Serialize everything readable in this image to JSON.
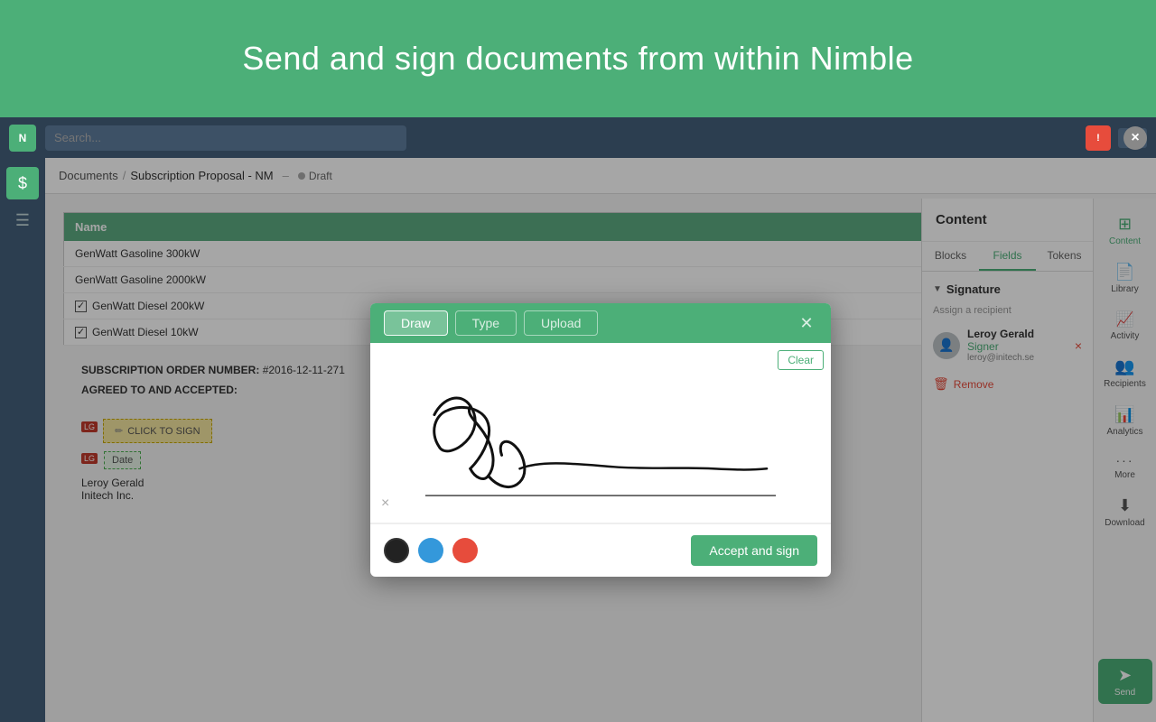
{
  "banner": {
    "title": "Send and sign documents from within Nimble"
  },
  "breadcrumb": {
    "documents": "Documents",
    "separator": "/",
    "current": "Subscription Proposal - NM",
    "dash": "–",
    "status": "Draft"
  },
  "table": {
    "header": "Name",
    "rows": [
      {
        "label": "GenWatt Gasoline 300kW",
        "checkbox": false
      },
      {
        "label": "GenWatt Gasoline 2000kW",
        "checkbox": false
      },
      {
        "label": "GenWatt Diesel 200kW",
        "checkbox": true
      },
      {
        "label": "GenWatt Diesel 10kW",
        "checkbox": true
      }
    ]
  },
  "doc_footer": {
    "order_number_label": "SUBSCRIPTION ORDER NUMBER:",
    "order_number": "#2016-12-11-271",
    "agreed_label": "AGREED TO AND ACCEPTED:",
    "click_to_sign": "CLICK TO SIGN",
    "date_label": "Date",
    "signer_name": "Leroy  Gerald",
    "signer_company": "Initech Inc."
  },
  "right_panel": {
    "title": "Content",
    "tabs": [
      "Blocks",
      "Fields",
      "Tokens"
    ],
    "active_tab": "Fields",
    "signature_section": "Signature",
    "assign_label": "Assign a recipient",
    "signer": {
      "name": "Leroy Gerald",
      "role": "Signer",
      "email": "leroy@initech.se"
    },
    "remove_label": "Remove"
  },
  "icon_strip": {
    "items": [
      {
        "id": "content",
        "label": "Content",
        "icon": "⊞",
        "active": true
      },
      {
        "id": "library",
        "label": "Library",
        "icon": "📄"
      },
      {
        "id": "activity",
        "label": "Activity",
        "icon": "📈"
      },
      {
        "id": "recipients",
        "label": "Recipients",
        "icon": "👥"
      },
      {
        "id": "analytics",
        "label": "Analytics",
        "icon": "📊"
      },
      {
        "id": "more",
        "label": "More",
        "icon": "···"
      },
      {
        "id": "download",
        "label": "Download",
        "icon": "⬇"
      }
    ],
    "send_label": "Send"
  },
  "modal": {
    "tabs": [
      "Draw",
      "Type",
      "Upload"
    ],
    "active_tab": "Draw",
    "clear_button": "Clear",
    "accept_button": "Accept and sign",
    "colors": [
      {
        "id": "black",
        "hex": "#222222",
        "selected": true
      },
      {
        "id": "blue",
        "hex": "#3498db",
        "selected": false
      },
      {
        "id": "red",
        "hex": "#e74c3c",
        "selected": false
      }
    ]
  },
  "close_button": "×"
}
